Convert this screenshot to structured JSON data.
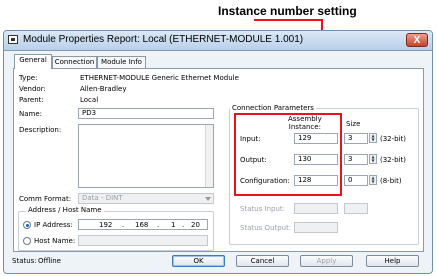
{
  "callout": {
    "label": "Instance number setting"
  },
  "window": {
    "title": "Module Properties Report: Local (ETHERNET-MODULE 1.001)",
    "close_glyph": "X"
  },
  "tabs": [
    {
      "label": "General"
    },
    {
      "label": "Connection"
    },
    {
      "label": "Module Info"
    }
  ],
  "general": {
    "type_label": "Type:",
    "type_value": "ETHERNET-MODULE Generic Ethernet Module",
    "vendor_label": "Vendor:",
    "vendor_value": "Allen-Bradley",
    "parent_label": "Parent:",
    "parent_value": "Local",
    "name_label": "Name:",
    "name_value": "PD3",
    "description_label": "Description:",
    "description_value": "",
    "comm_format_label": "Comm Format:",
    "comm_format_value": "Data - DINT"
  },
  "address": {
    "group_title": "Address / Host Name",
    "ip_label": "IP Address:",
    "ip_octets": [
      "192",
      "168",
      "1",
      "20"
    ],
    "ip_selected": true,
    "host_label": "Host Name:",
    "host_value": ""
  },
  "connection_parameters": {
    "title": "Connection Parameters",
    "assembly_header": "Assembly\nInstance:",
    "size_header": "Size",
    "rows": [
      {
        "label": "Input:",
        "instance": "129",
        "size": "3",
        "unit": "(32-bit)"
      },
      {
        "label": "Output:",
        "instance": "130",
        "size": "3",
        "unit": "(32-bit)"
      },
      {
        "label": "Configuration:",
        "instance": "128",
        "size": "0",
        "unit": "(8-bit)"
      }
    ],
    "status_input_label": "Status Input:",
    "status_output_label": "Status Output:"
  },
  "footer": {
    "status_label": "Status:",
    "status_value": "Offline"
  },
  "buttons": {
    "ok": "OK",
    "cancel": "Cancel",
    "apply": "Apply",
    "help": "Help"
  },
  "colors": {
    "highlight": "#e8141a",
    "titlebar": "#c6d9ef",
    "window_bg": "#eef3f8"
  }
}
